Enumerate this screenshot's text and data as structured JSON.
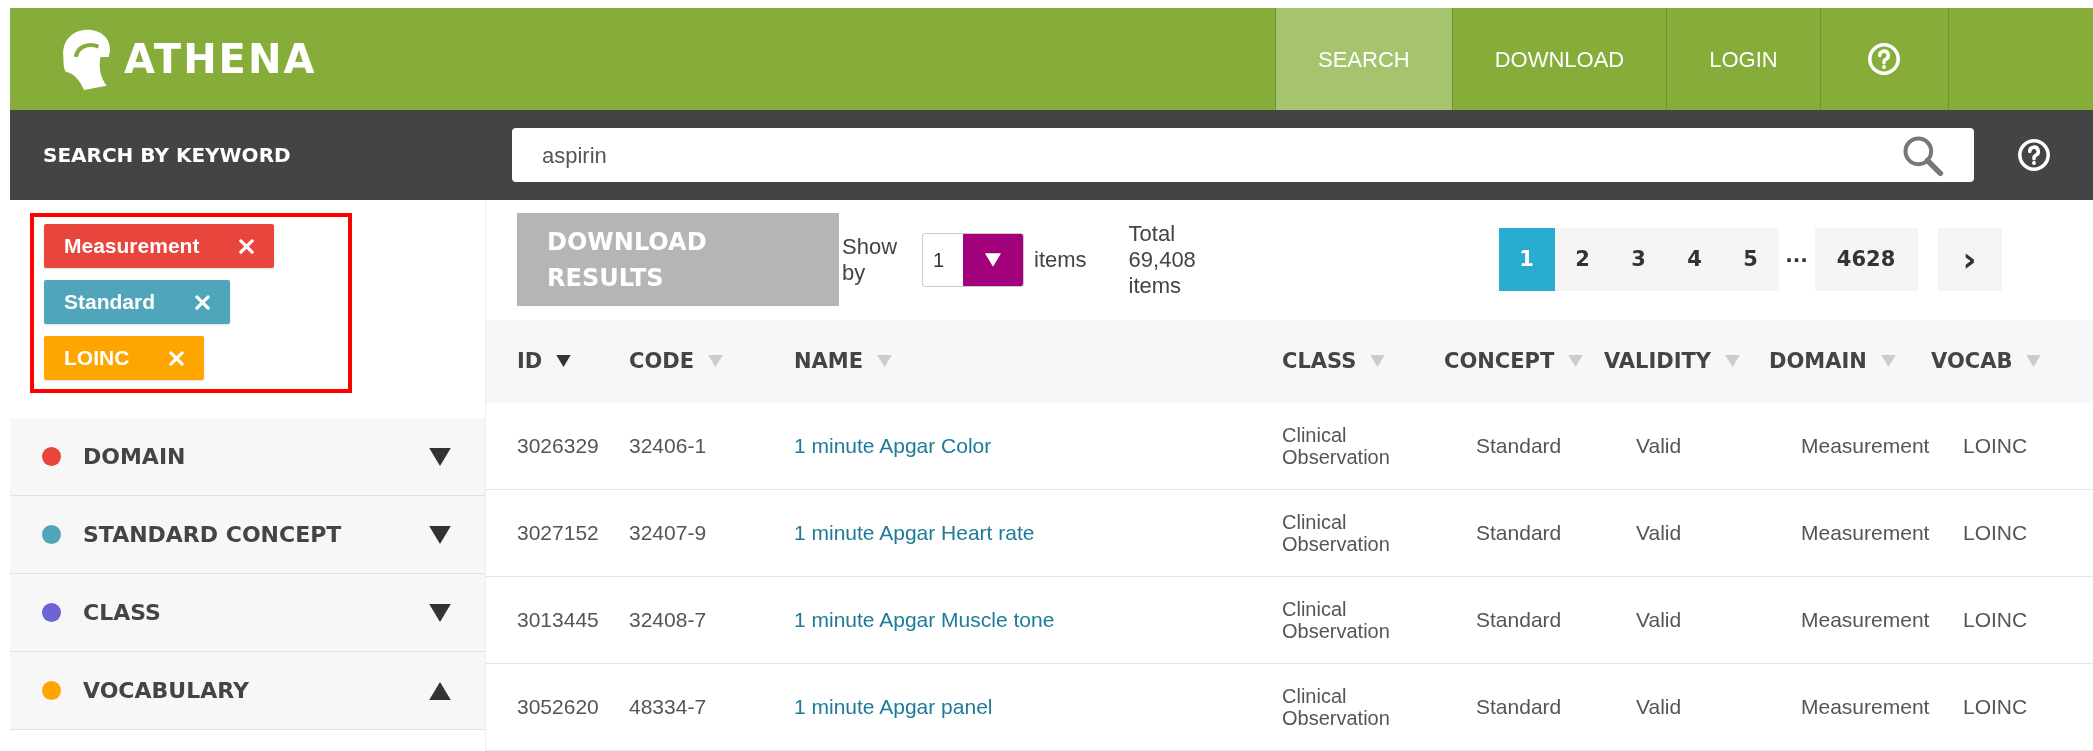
{
  "header": {
    "logo": "ATHENA",
    "nav": [
      {
        "label": "SEARCH",
        "selected": true,
        "kind": "text"
      },
      {
        "label": "DOWNLOAD",
        "selected": false,
        "kind": "text"
      },
      {
        "label": "LOGIN",
        "selected": false,
        "kind": "text"
      },
      {
        "selected": false,
        "kind": "icon"
      }
    ]
  },
  "search_bar": {
    "title": "SEARCH BY KEYWORD",
    "value": "aspirin"
  },
  "filters": {
    "chips": [
      {
        "label": "Measurement",
        "color": "#e8453c"
      },
      {
        "label": "Standard",
        "color": "#4fa5ba"
      },
      {
        "label": "LOINC",
        "color": "#ffa500"
      }
    ],
    "sections": [
      {
        "label": "DOMAIN",
        "color": "#e8453c",
        "expanded": false
      },
      {
        "label": "STANDARD CONCEPT",
        "color": "#4fa5ba",
        "expanded": false
      },
      {
        "label": "CLASS",
        "color": "#6c63d4",
        "expanded": false
      },
      {
        "label": "VOCABULARY",
        "color": "#ffa500",
        "expanded": true
      }
    ]
  },
  "toolbar": {
    "download": "DOWNLOAD RESULTS",
    "show_by": "Show by",
    "page_size": "1",
    "items": "items",
    "total": "Total 69,408 items",
    "pages": [
      {
        "label": "1",
        "selected": true
      },
      {
        "label": "2",
        "selected": false
      },
      {
        "label": "3",
        "selected": false
      },
      {
        "label": "4",
        "selected": false
      },
      {
        "label": "5",
        "selected": false
      }
    ],
    "ellipsis": "···",
    "last_page": "4628",
    "next": "›"
  },
  "table": {
    "columns": [
      {
        "label": "ID",
        "sorted": true
      },
      {
        "label": "CODE",
        "sorted": false
      },
      {
        "label": "NAME",
        "sorted": false
      },
      {
        "label": "CLASS",
        "sorted": false
      },
      {
        "label": "CONCEPT",
        "sorted": false
      },
      {
        "label": "VALIDITY",
        "sorted": false
      },
      {
        "label": "DOMAIN",
        "sorted": false
      },
      {
        "label": "VOCAB",
        "sorted": false
      }
    ],
    "rows": [
      [
        "3026329",
        "32406-1",
        "1 minute Apgar Color",
        "Clinical Observation",
        "Standard",
        "Valid",
        "Measurement",
        "LOINC"
      ],
      [
        "3027152",
        "32407-9",
        "1 minute Apgar Heart rate",
        "Clinical Observation",
        "Standard",
        "Valid",
        "Measurement",
        "LOINC"
      ],
      [
        "3013445",
        "32408-7",
        "1 minute Apgar Muscle tone",
        "Clinical Observation",
        "Standard",
        "Valid",
        "Measurement",
        "LOINC"
      ],
      [
        "3052620",
        "48334-7",
        "1 minute Apgar panel",
        "Clinical Observation",
        "Standard",
        "Valid",
        "Measurement",
        "LOINC"
      ]
    ]
  }
}
